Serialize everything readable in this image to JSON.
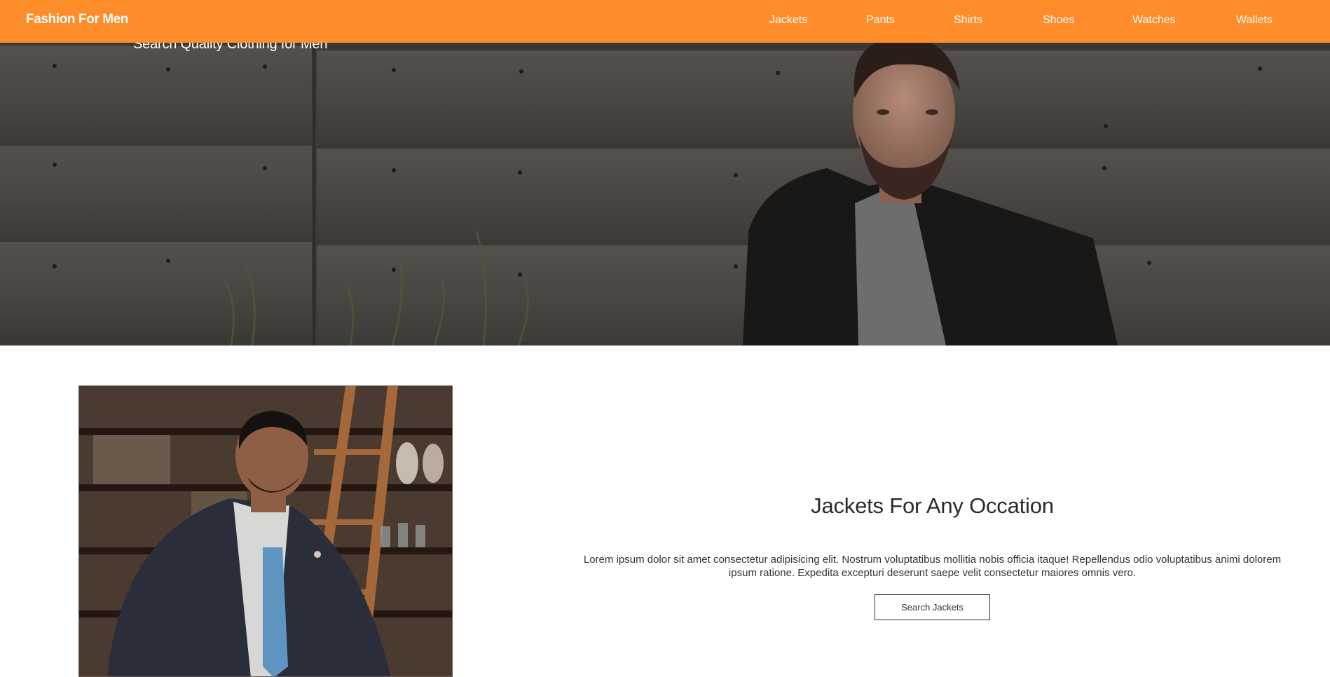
{
  "nav": {
    "brand": "Fashion For Men",
    "items": [
      {
        "label": "Jackets"
      },
      {
        "label": "Pants"
      },
      {
        "label": "Shirts"
      },
      {
        "label": "Shoes"
      },
      {
        "label": "Watches"
      },
      {
        "label": "Wallets"
      }
    ],
    "bar_color": "#ff8c2a"
  },
  "hero": {
    "tagline": "Search Quality Clothing for Men"
  },
  "feature": {
    "title": "Jackets For Any Occation",
    "body": "Lorem ipsum dolor sit amet consectetur adipisicing elit. Nostrum voluptatibus mollitia nobis officia itaque! Repellendus odio voluptatibus animi dolorem ipsum ratione. Expedita excepturi deserunt saepe velit consectetur maiores omnis vero.",
    "button_label": "Search Jackets"
  }
}
